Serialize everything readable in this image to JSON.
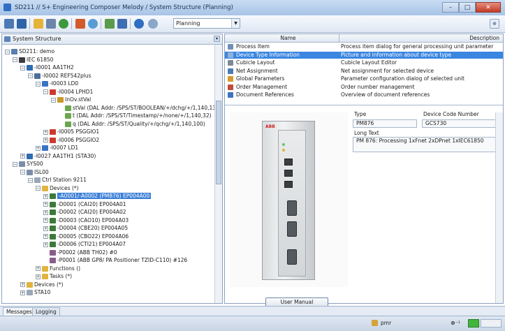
{
  "window": {
    "title": "SD211 // S+ Engineering Composer Melody / System Structure (Planning)",
    "controls": {
      "minimize": "–",
      "maximize": "□",
      "close": "✕"
    }
  },
  "toolbar": {
    "mode_value": "Planning",
    "icons": [
      "grid-icon",
      "save-icon",
      "folder-icon",
      "disk-icon",
      "refresh-icon",
      "pen-icon",
      "search-icon",
      "tree-icon",
      "filter-icon",
      "info-icon",
      "help-icon"
    ],
    "right_icon": "⊕"
  },
  "left_pane": {
    "title": "System Structure",
    "tree": [
      {
        "label": "SD211: demo",
        "level": 0,
        "icon": "project",
        "exp": "−"
      },
      {
        "label": "IEC 61850",
        "level": 1,
        "icon": "network",
        "exp": "−"
      },
      {
        "label": "-I0001 AA1TH2",
        "level": 2,
        "icon": "bay",
        "exp": "−"
      },
      {
        "label": "-I0002 REF542plus",
        "level": 3,
        "icon": "device",
        "exp": "−"
      },
      {
        "label": "-I0003 LD0",
        "level": 4,
        "icon": "ld",
        "exp": "−"
      },
      {
        "label": "-I0004 LPHD1",
        "level": 5,
        "icon": "ln",
        "exp": "−"
      },
      {
        "label": "InOv.stVal",
        "level": 6,
        "icon": "data",
        "exp": "−"
      },
      {
        "label": "stVal (DAL Addr: /SPS/ST/BOOLEAN/+/dchg/+/1,140,13)",
        "level": 7,
        "icon": "attr",
        "exp": ""
      },
      {
        "label": "t    (DAL Addr: /SPS/ST/Timestamp/+/none/+/1,140,32)",
        "level": 7,
        "icon": "attr",
        "exp": ""
      },
      {
        "label": "q    (DAL Addr: /SPS/ST/Quality/+/qchg/+/1,140,100)",
        "level": 7,
        "icon": "attr",
        "exp": ""
      },
      {
        "label": "-I0005 PSGGIO1",
        "level": 5,
        "icon": "ln",
        "exp": "+"
      },
      {
        "label": "-I0006 PSGGIO2",
        "level": 5,
        "icon": "ln",
        "exp": "+"
      },
      {
        "label": "-I0007 LD1",
        "level": 4,
        "icon": "ld",
        "exp": "+"
      },
      {
        "label": "-I0027 AA1TH1 (STA30)",
        "level": 2,
        "icon": "bay",
        "exp": "+"
      },
      {
        "label": "SYS00",
        "level": 1,
        "icon": "system",
        "exp": "−"
      },
      {
        "label": "ISL00",
        "level": 2,
        "icon": "system",
        "exp": "−"
      },
      {
        "label": "Ctrl Station 9211",
        "level": 3,
        "icon": "station",
        "exp": "−"
      },
      {
        "label": "Devices (*)",
        "level": 4,
        "icon": "folder",
        "exp": "−"
      },
      {
        "label": "-A0001/-A0002 (PM876) EP004A00",
        "level": 5,
        "icon": "module",
        "exp": "+",
        "selected": true
      },
      {
        "label": "-D0001 (CAI20) EP004A01",
        "level": 5,
        "icon": "module",
        "exp": "+"
      },
      {
        "label": "-D0002 (CAI20) EP004A02",
        "level": 5,
        "icon": "module",
        "exp": "+"
      },
      {
        "label": "-D0003 (CAO10) EP004A03",
        "level": 5,
        "icon": "module",
        "exp": "+"
      },
      {
        "label": "-D0004 (CBE20) EP004A05",
        "level": 5,
        "icon": "module",
        "exp": "+"
      },
      {
        "label": "-D0005 (CBO22) EP004A06",
        "level": 5,
        "icon": "module",
        "exp": "+"
      },
      {
        "label": "-D0006 (CTI21) EP004A07",
        "level": 5,
        "icon": "module",
        "exp": "+"
      },
      {
        "label": "-P0002 (ABB TH02)  #0",
        "level": 5,
        "icon": "positioner",
        "exp": ""
      },
      {
        "label": "-P0001 (ABB GP8/ PA Positioner TZID-C110)  #126",
        "level": 5,
        "icon": "positioner",
        "exp": ""
      },
      {
        "label": "Functions ()",
        "level": 4,
        "icon": "folder",
        "exp": "+"
      },
      {
        "label": "Tasks (*)",
        "level": 4,
        "icon": "folder",
        "exp": "+"
      },
      {
        "label": "Devices (*)",
        "level": 2,
        "icon": "folder",
        "exp": "+"
      },
      {
        "label": "STA10",
        "level": 2,
        "icon": "station",
        "exp": "+"
      }
    ]
  },
  "grid": {
    "headers": {
      "name": "Name",
      "description": "Description"
    },
    "rows": [
      {
        "name": "Process Item",
        "desc": "Process item dialog for general processing unit parameter",
        "color": "#6f8fb8"
      },
      {
        "name": "Device Type Information",
        "desc": "Picture and information about device type",
        "color": "#8fb1de",
        "selected": true
      },
      {
        "name": "Cubicle Layout",
        "desc": "Cubicle Layout Editor",
        "color": "#7c8896"
      },
      {
        "name": "Net Assignment",
        "desc": "Net assignment for selected device",
        "color": "#4d7bb6"
      },
      {
        "name": "Global Parameters",
        "desc": "Parameter configuration dialog of selected unit",
        "color": "#d89a2f"
      },
      {
        "name": "Order Management",
        "desc": "Order number management",
        "color": "#c24a3c"
      },
      {
        "name": "Document References",
        "desc": "Overview of document references",
        "color": "#3f73c0"
      }
    ]
  },
  "details": {
    "type_label": "Type",
    "type_value": "PM876",
    "code_label": "Device Code Number",
    "code_value": "GCS730",
    "long_text_label": "Long Text",
    "long_text_value": "PM 876: Processing 1xFnet 2xDPnet 1xIEC61850",
    "module_brand": "ABB",
    "user_manual_button": "User Manual"
  },
  "tabs": [
    "Messages",
    "Logging"
  ],
  "status": {
    "user": "pmr",
    "indicator": "⊕⁻¹"
  }
}
